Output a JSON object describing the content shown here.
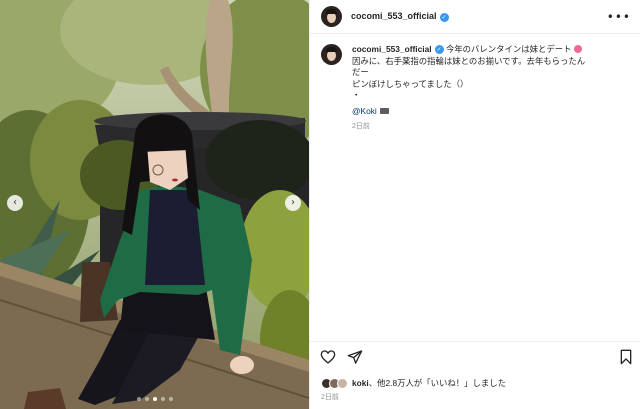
{
  "post": {
    "username": "cocomi_553_official",
    "verified_badge": "✓",
    "more_icon": "•••",
    "caption": {
      "line1": "今年のバレンタインは妹とデート",
      "line2": "因みに、右手薬指の指輪は妹とのお揃いです。去年もらったん",
      "line3": "だー",
      "line4": "ピンぼけしちゃってました（）",
      "line5": "・",
      "mention": "@Koki",
      "emoji_flower": "flower-emoji",
      "emoji_camera": "camera-emoji"
    },
    "caption_time": "2日前",
    "likes": {
      "text_bold_user": "koki",
      "text_rest": "、他2.8万人が「いいね！」しました"
    },
    "posted_time": "2日前",
    "carousel": {
      "prev_icon": "‹",
      "next_icon": "›",
      "slide_count": 5,
      "active_index": 2
    }
  },
  "icons": {
    "like": "heart-icon",
    "share": "paper-plane-icon",
    "save": "bookmark-icon"
  },
  "colors": {
    "verified": "#3897f0",
    "mention": "#00376b",
    "meta_gray": "#8e8e8e",
    "cardigan": "#1f6b45"
  }
}
